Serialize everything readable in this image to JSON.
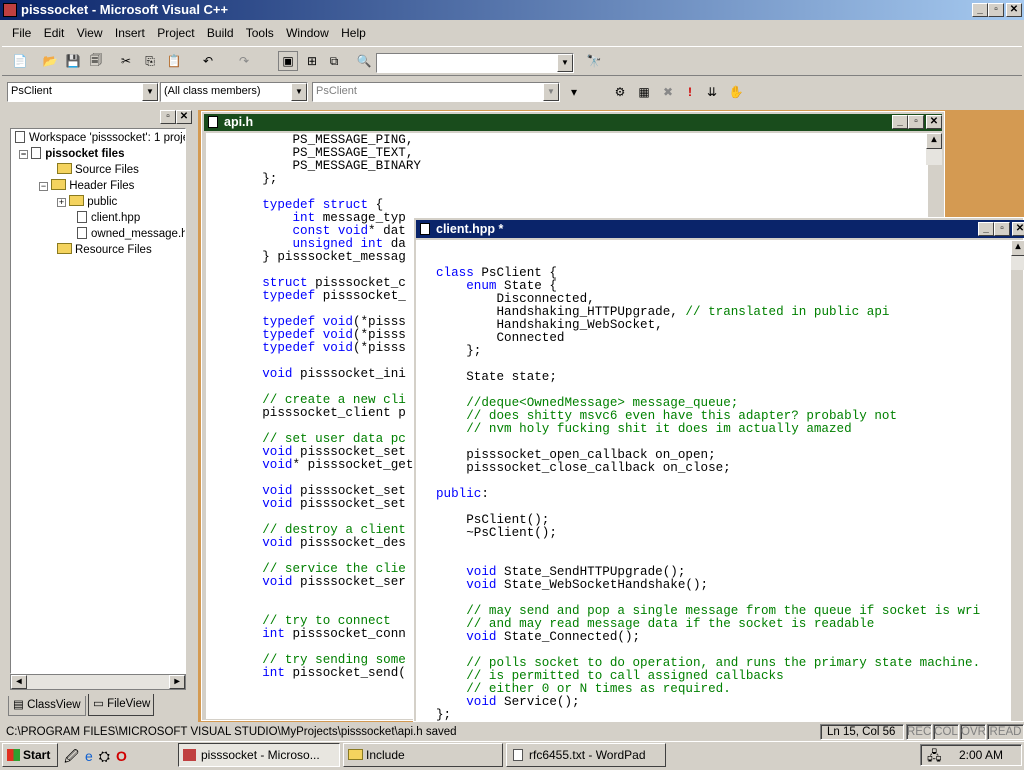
{
  "app": {
    "title": "pisssocket - Microsoft Visual C++",
    "menu": [
      "File",
      "Edit",
      "View",
      "Insert",
      "Project",
      "Build",
      "Tools",
      "Window",
      "Help"
    ]
  },
  "wizardbar": {
    "class_combo": "PsClient",
    "members_combo": "(All class members)",
    "scope_combo": "PsClient"
  },
  "workspace": {
    "root": "Workspace 'pisssocket': 1 proje",
    "project": "pissocket files",
    "items": [
      "Source Files",
      "Header Files",
      "public",
      "client.hpp",
      "owned_message.h",
      "Resource Files"
    ],
    "tabs": [
      "ClassView",
      "FileView"
    ]
  },
  "api": {
    "title": "api.h",
    "lines": [
      [
        [
          "",
          "        PS_MESSAGE_PING,"
        ]
      ],
      [
        [
          "",
          "        PS_MESSAGE_TEXT,"
        ]
      ],
      [
        [
          "",
          "        PS_MESSAGE_BINARY"
        ]
      ],
      [
        [
          "",
          "    };"
        ]
      ],
      [
        [
          "",
          ""
        ]
      ],
      [
        [
          "",
          "    "
        ],
        [
          "kw",
          "typedef struct"
        ],
        [
          "",
          " {"
        ]
      ],
      [
        [
          "",
          "        "
        ],
        [
          "kw",
          "int"
        ],
        [
          "",
          " message_typ"
        ]
      ],
      [
        [
          "",
          "        "
        ],
        [
          "kw",
          "const void"
        ],
        [
          "",
          "* dat"
        ]
      ],
      [
        [
          "",
          "        "
        ],
        [
          "kw",
          "unsigned int"
        ],
        [
          "",
          " da"
        ]
      ],
      [
        [
          "",
          "    } pisssocket_messag"
        ]
      ],
      [
        [
          "",
          ""
        ]
      ],
      [
        [
          "",
          "    "
        ],
        [
          "kw",
          "struct"
        ],
        [
          "",
          " pisssocket_c"
        ]
      ],
      [
        [
          "",
          "    "
        ],
        [
          "kw",
          "typedef"
        ],
        [
          "",
          " pisssocket_"
        ]
      ],
      [
        [
          "",
          ""
        ]
      ],
      [
        [
          "",
          "    "
        ],
        [
          "kw",
          "typedef void"
        ],
        [
          "",
          "(*pisss"
        ]
      ],
      [
        [
          "",
          "    "
        ],
        [
          "kw",
          "typedef void"
        ],
        [
          "",
          "(*pisss"
        ]
      ],
      [
        [
          "",
          "    "
        ],
        [
          "kw",
          "typedef void"
        ],
        [
          "",
          "(*pisss"
        ]
      ],
      [
        [
          "",
          ""
        ]
      ],
      [
        [
          "",
          "    "
        ],
        [
          "kw",
          "void"
        ],
        [
          "",
          " pisssocket_ini"
        ]
      ],
      [
        [
          "",
          ""
        ]
      ],
      [
        [
          "",
          "    "
        ],
        [
          "cm",
          "// create a new cli"
        ]
      ],
      [
        [
          "",
          "    pisssocket_client p"
        ]
      ],
      [
        [
          "",
          ""
        ]
      ],
      [
        [
          "",
          "    "
        ],
        [
          "cm",
          "// set user data pc"
        ]
      ],
      [
        [
          "",
          "    "
        ],
        [
          "kw",
          "void"
        ],
        [
          "",
          " pisssocket_set"
        ]
      ],
      [
        [
          "",
          "    "
        ],
        [
          "kw",
          "void"
        ],
        [
          "",
          "* pisssocket_get"
        ]
      ],
      [
        [
          "",
          ""
        ]
      ],
      [
        [
          "",
          "    "
        ],
        [
          "kw",
          "void"
        ],
        [
          "",
          " pisssocket_set"
        ]
      ],
      [
        [
          "",
          "    "
        ],
        [
          "kw",
          "void"
        ],
        [
          "",
          " pisssocket_set"
        ]
      ],
      [
        [
          "",
          ""
        ]
      ],
      [
        [
          "",
          "    "
        ],
        [
          "cm",
          "// destroy a client"
        ]
      ],
      [
        [
          "",
          "    "
        ],
        [
          "kw",
          "void"
        ],
        [
          "",
          " pisssocket_des"
        ]
      ],
      [
        [
          "",
          ""
        ]
      ],
      [
        [
          "",
          "    "
        ],
        [
          "cm",
          "// service the clie"
        ]
      ],
      [
        [
          "",
          "    "
        ],
        [
          "kw",
          "void"
        ],
        [
          "",
          " pisssocket_ser"
        ]
      ],
      [
        [
          "",
          ""
        ]
      ],
      [
        [
          "",
          ""
        ]
      ],
      [
        [
          "",
          "    "
        ],
        [
          "cm",
          "// try to connect"
        ]
      ],
      [
        [
          "",
          "    "
        ],
        [
          "kw",
          "int"
        ],
        [
          "",
          " pisssocket_conn"
        ]
      ],
      [
        [
          "",
          ""
        ]
      ],
      [
        [
          "",
          "    "
        ],
        [
          "cm",
          "// try sending some"
        ]
      ],
      [
        [
          "",
          "    "
        ],
        [
          "kw",
          "int"
        ],
        [
          "",
          " pissocket_send("
        ]
      ]
    ]
  },
  "client": {
    "title": "client.hpp *",
    "lines": [
      [
        [
          "",
          ""
        ]
      ],
      [
        [
          "kw",
          "class"
        ],
        [
          "",
          " PsClient {"
        ]
      ],
      [
        [
          "",
          "    "
        ],
        [
          "kw",
          "enum"
        ],
        [
          "",
          " State {"
        ]
      ],
      [
        [
          "",
          "        Disconnected,"
        ]
      ],
      [
        [
          "",
          "        Handshaking_HTTPUpgrade, "
        ],
        [
          "cm",
          "// translated in public api"
        ]
      ],
      [
        [
          "",
          "        Handshaking_WebSocket,"
        ]
      ],
      [
        [
          "",
          "        Connected"
        ]
      ],
      [
        [
          "",
          "    };"
        ]
      ],
      [
        [
          "",
          ""
        ]
      ],
      [
        [
          "",
          "    State state;"
        ]
      ],
      [
        [
          "",
          ""
        ]
      ],
      [
        [
          "",
          "    "
        ],
        [
          "cm",
          "//deque<OwnedMessage> message_queue;"
        ]
      ],
      [
        [
          "",
          "    "
        ],
        [
          "cm",
          "// does shitty msvc6 even have this adapter? probably not"
        ]
      ],
      [
        [
          "",
          "    "
        ],
        [
          "cm",
          "// nvm holy fucking shit it does im actually amazed"
        ]
      ],
      [
        [
          "",
          ""
        ]
      ],
      [
        [
          "",
          "    pisssocket_open_callback on_open;"
        ]
      ],
      [
        [
          "",
          "    pisssocket_close_callback on_close;"
        ]
      ],
      [
        [
          "",
          ""
        ]
      ],
      [
        [
          "kw",
          "public"
        ],
        [
          "",
          ":"
        ]
      ],
      [
        [
          "",
          ""
        ]
      ],
      [
        [
          "",
          "    PsClient();"
        ]
      ],
      [
        [
          "",
          "    ~PsClient();"
        ]
      ],
      [
        [
          "",
          ""
        ]
      ],
      [
        [
          "",
          ""
        ]
      ],
      [
        [
          "",
          "    "
        ],
        [
          "kw",
          "void"
        ],
        [
          "",
          " State_SendHTTPUpgrade();"
        ]
      ],
      [
        [
          "",
          "    "
        ],
        [
          "kw",
          "void"
        ],
        [
          "",
          " State_WebSocketHandshake();"
        ]
      ],
      [
        [
          "",
          ""
        ]
      ],
      [
        [
          "",
          "    "
        ],
        [
          "cm",
          "// may send and pop a single message from the queue if socket is wri"
        ]
      ],
      [
        [
          "",
          "    "
        ],
        [
          "cm",
          "// and may read message data if the socket is readable"
        ]
      ],
      [
        [
          "",
          "    "
        ],
        [
          "kw",
          "void"
        ],
        [
          "",
          " State_Connected();"
        ]
      ],
      [
        [
          "",
          ""
        ]
      ],
      [
        [
          "",
          "    "
        ],
        [
          "cm",
          "// polls socket to do operation, and runs the primary state machine."
        ]
      ],
      [
        [
          "",
          "    "
        ],
        [
          "cm",
          "// is permitted to call assigned callbacks"
        ]
      ],
      [
        [
          "",
          "    "
        ],
        [
          "cm",
          "// either 0 or N times as required."
        ]
      ],
      [
        [
          "",
          "    "
        ],
        [
          "kw",
          "void"
        ],
        [
          "",
          " Service();"
        ]
      ],
      [
        [
          "",
          "};"
        ]
      ]
    ]
  },
  "status": {
    "path": "C:\\PROGRAM FILES\\MICROSOFT VISUAL STUDIO\\MyProjects\\pisssocket\\api.h saved",
    "pos": "Ln 15, Col 56",
    "ind": [
      "REC",
      "COL",
      "OVR",
      "READ"
    ]
  },
  "taskbar": {
    "start": "Start",
    "tasks": [
      "pisssocket - Microso...",
      "Include",
      "rfc6455.txt - WordPad"
    ],
    "clock": "2:00 AM"
  },
  "colors": {
    "title": "#0a246a",
    "dark_title": "#194c1c"
  }
}
